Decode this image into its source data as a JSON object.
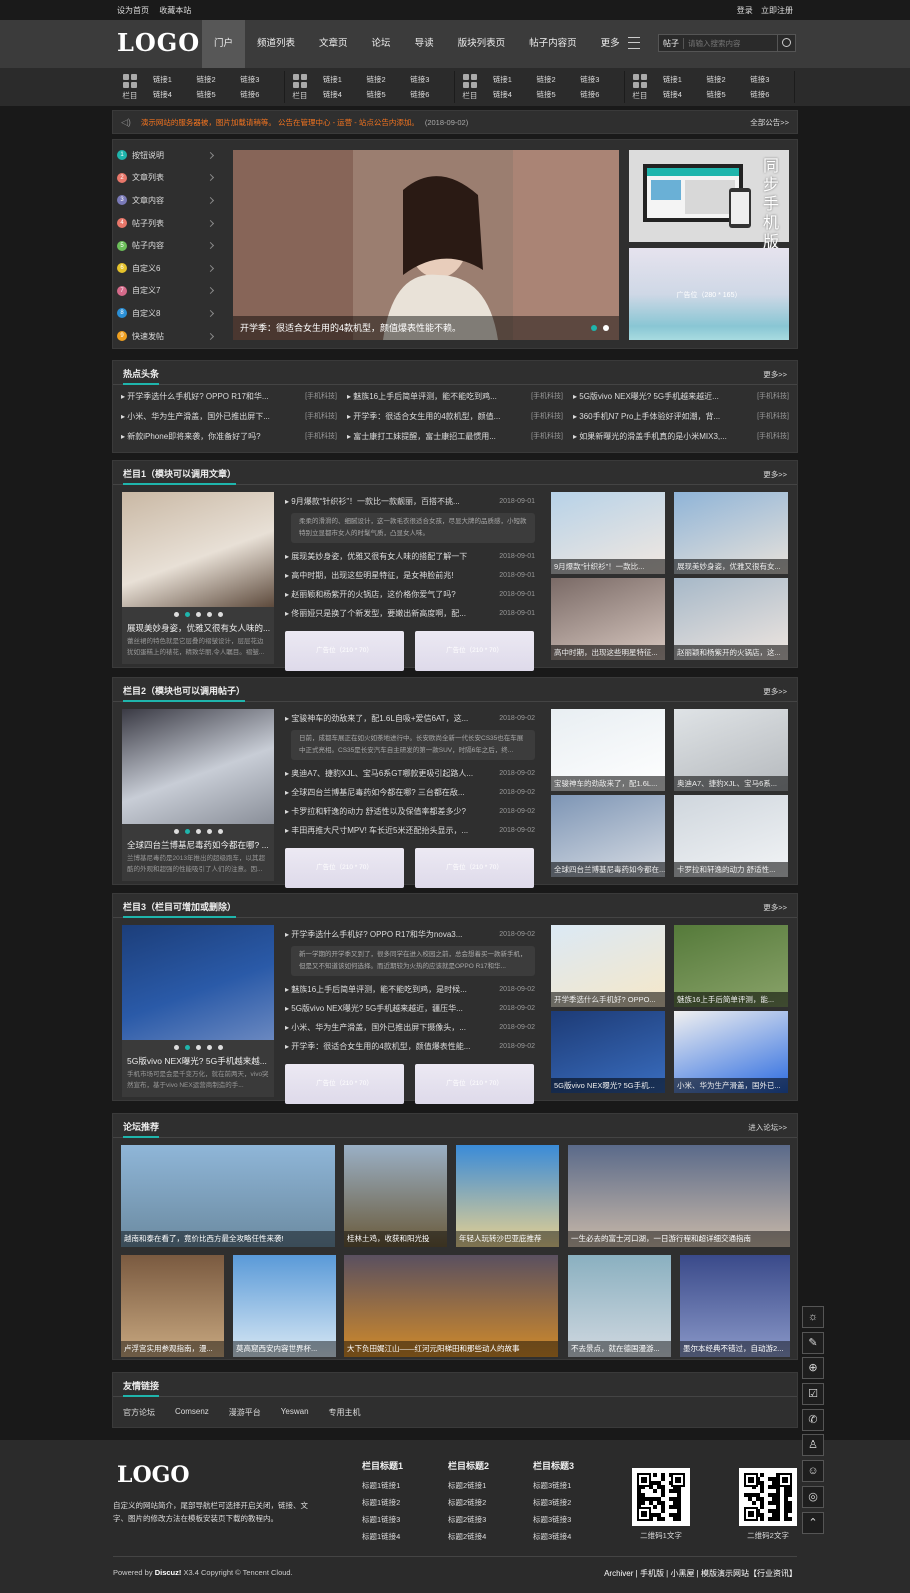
{
  "topbar": {
    "left": [
      "设为首页",
      "收藏本站"
    ],
    "right": [
      "登录",
      "立即注册"
    ]
  },
  "header": {
    "logo": "LOGO",
    "nav": [
      "门户",
      "频道列表",
      "文章页",
      "论坛",
      "导读",
      "版块列表页",
      "帖子内容页",
      "更多"
    ],
    "search_type": "帖子",
    "search_placeholder": "请输入搜索内容"
  },
  "subnav": [
    {
      "label": "栏目",
      "links": [
        "链接1",
        "链接2",
        "链接3",
        "链接4",
        "链接5",
        "链接6"
      ]
    },
    {
      "label": "栏目",
      "links": [
        "链接1",
        "链接2",
        "链接3",
        "链接4",
        "链接5",
        "链接6"
      ]
    },
    {
      "label": "栏目",
      "links": [
        "链接1",
        "链接2",
        "链接3",
        "链接4",
        "链接5",
        "链接6"
      ]
    },
    {
      "label": "栏目",
      "links": [
        "链接1",
        "链接2",
        "链接3",
        "链接4",
        "链接5",
        "链接6"
      ]
    }
  ],
  "notice": {
    "text": "演示网站的服务器被，图片加载请稍等。 公告在管理中心 - 运营 - 站点公告内添加。",
    "date": "(2018-09-02)",
    "more": "全部公告>>"
  },
  "sidebar": [
    {
      "num": "1",
      "label": "按钮说明",
      "color": "#1fb5ac"
    },
    {
      "num": "2",
      "label": "文章列表",
      "color": "#e8776a"
    },
    {
      "num": "3",
      "label": "文章内容",
      "color": "#7a7ab8"
    },
    {
      "num": "4",
      "label": "帖子列表",
      "color": "#e8776a"
    },
    {
      "num": "5",
      "label": "帖子内容",
      "color": "#6cbf5a"
    },
    {
      "num": "6",
      "label": "自定义6",
      "color": "#e5c22b"
    },
    {
      "num": "7",
      "label": "自定义7",
      "color": "#d56a8a"
    },
    {
      "num": "8",
      "label": "自定义8",
      "color": "#2a8fd6"
    },
    {
      "num": "9",
      "label": "快速发帖",
      "color": "#f0a020"
    }
  ],
  "slider": {
    "caption": "开学季：很适合女生用的4款机型，颜值爆表性能不赖。"
  },
  "hero_right": {
    "promo": "同步手机版",
    "ad": "广告位（280 * 165）"
  },
  "hot": {
    "title": "热点头条",
    "more": "更多>>",
    "items": [
      {
        "t": "开学季选什么手机好? OPPO R17和华...",
        "tag": "[手机科技]"
      },
      {
        "t": "魅族16上手后简单评测，能不能吃到鸡...",
        "tag": "[手机科技]"
      },
      {
        "t": "5G版vivo NEX曝光? 5G手机越来越近...",
        "tag": "[手机科技]"
      },
      {
        "t": "小米、华为生产滑盖，国外已推出屏下...",
        "tag": "[手机科技]"
      },
      {
        "t": "开学季：很适合女生用的4款机型，颜值...",
        "tag": "[手机科技]"
      },
      {
        "t": "360手机N7 Pro上手体验好评如潮，背...",
        "tag": "[手机科技]"
      },
      {
        "t": "新款iPhone即将来袭，你准备好了吗?",
        "tag": "[手机科技]"
      },
      {
        "t": "富士康打工妹提醒，富士康招工最惯用...",
        "tag": "[手机科技]"
      },
      {
        "t": "如果新曝光的滑盖手机真的是小米MIX3,...",
        "tag": "[手机科技]"
      }
    ]
  },
  "sections": [
    {
      "title": "栏目1（模块可以调用文章）",
      "more": "更多>>",
      "big": {
        "title": "展现美妙身姿，优雅又很有女人味的...",
        "desc": "蕾丝裙的特色就是它层叠的褶皱设计，层层花边犹如蛋糕上的裱花，精致华丽,令人瞩目。褶皱..."
      },
      "list": [
        {
          "t": "9月爆款“针织衫”！一款比一款靓丽，百搭不挑...",
          "d": "2018-09-01"
        },
        {
          "t": "展现美妙身姿，优雅又很有女人味的搭配了解一下",
          "d": "2018-09-01"
        },
        {
          "t": "高中时期，出现这些明星特征，是女神脸前兆!",
          "d": "2018-09-01"
        },
        {
          "t": "赵丽颖和杨紫开的火锅店，这价格你爱气了吗?",
          "d": "2018-09-01"
        },
        {
          "t": "佟丽娅只是换了个新发型，要嫩出新高度啊，配...",
          "d": "2018-09-01"
        }
      ],
      "summary": "柔柔的滑滑的、细腻设计，这一款毛衣很适合女孩，尽显大牌的品质感，小短款特别立显都市女人的时髦气质，凸显女人味。",
      "ads": [
        "广告位（210 * 70）",
        "广告位（210 * 70）"
      ],
      "thumbs": [
        "9月爆款“针织衫”！一款比...",
        "展现美妙身姿，优雅又很有女...",
        "高中时期，出现这些明星特征...",
        "赵丽颖和杨紫开的火锅店，这..."
      ]
    },
    {
      "title": "栏目2（模块也可以调用帖子）",
      "more": "更多>>",
      "big": {
        "title": "全球四台兰博基尼毒药如今都在哪? ...",
        "desc": "兰博基尼毒药是2013年推出的超级跑车，以其超酷的外观和超强的性能吸引了人们的注意。因..."
      },
      "list": [
        {
          "t": "宝骏神车的劲敌来了，配1.6L自吸+爱信6AT，这...",
          "d": "2018-09-02"
        },
        {
          "t": "奥迪A7、捷豹XJL、宝马6系GT哪款更吸引起路人...",
          "d": "2018-09-02"
        },
        {
          "t": "全球四台兰博基尼毒药如今都在哪? 三台都在敌...",
          "d": "2018-09-02"
        },
        {
          "t": "卡罗拉和轩逸的动力 舒适性以及保值率都差多少?",
          "d": "2018-09-02"
        },
        {
          "t": "丰田再推大尺寸MPV! 车长近5米还配抬头显示，...",
          "d": "2018-09-02"
        }
      ],
      "summary": "日前，成都车展正在如火如荼地进行中。长安欧尚全新一代长安CS35也在车展中正式亮相。CS35是长安汽车自主研发的第一款SUV，时隔6年之后，终...",
      "ads": [
        "广告位（210 * 70）",
        "广告位（210 * 70）"
      ],
      "thumbs": [
        "宝骏神车的劲敌来了，配1.6L...",
        "奥迪A7、捷豹XJL、宝马6系...",
        "全球四台兰博基尼毒药如今都在...",
        "卡罗拉和轩逸的动力 舒适性..."
      ]
    },
    {
      "title": "栏目3（栏目可增加或删除）",
      "more": "更多>>",
      "big": {
        "title": "5G版vivo NEX曝光? 5G手机越来越...",
        "desc": "手机市场可是会是千变万化，就在前两天，vivo突然宣布，基于vivo NEX运营商制造的手..."
      },
      "list": [
        {
          "t": "开学季选什么手机好? OPPO R17和华为nova3...",
          "d": "2018-09-02"
        },
        {
          "t": "魅族16上手后简单评测，能不能吃到鸡，是时候...",
          "d": "2018-09-02"
        },
        {
          "t": "5G版vivo NEX曝光? 5G手机越来越近，疆压华...",
          "d": "2018-09-02"
        },
        {
          "t": "小米、华为生产滑盖，国外已推出屏下摄像头，...",
          "d": "2018-09-02"
        },
        {
          "t": "开学季：很适合女生用的4款机型，颜值爆表性能...",
          "d": "2018-09-02"
        }
      ],
      "summary": "新一学期的开学季又到了，很多同学在进入校园之前，总会想着买一款新手机，但是又不知道该如何选择。而近期较为火热的应该就是OPPO R17和华...",
      "ads": [
        "广告位（210 * 70）",
        "广告位（210 * 70）"
      ],
      "thumbs": [
        "开学季选什么手机好? OPPO...",
        "魅族16上手后简单评测，能...",
        "5G版vivo NEX曝光? 5G手机...",
        "小米、华为生产滑盖，国外已..."
      ]
    }
  ],
  "forum": {
    "title": "论坛推荐",
    "more": "进入论坛>>",
    "items": [
      "越南和泰在看了，竟价比西方最全攻略任性来袭!",
      "桂林土鸡，收获和阳光投",
      "年轻人玩转沙巴亚庇推荐",
      "一生必去的富士河口湖，一日游行程和超详细交通指南",
      "卢浮宫实用参观指南，漫...",
      "莫高窟西安内容世界杯...",
      "大下负田娓江山——红河元阳梯田和那些动人的故事",
      "不去景点，就在德国漫游...",
      "墨尔本经典不错过，自动游2..."
    ]
  },
  "friendlinks": {
    "title": "友情链接",
    "items": [
      "官方论坛",
      "Comsenz",
      "漫游平台",
      "Yeswan",
      "专用主机"
    ]
  },
  "footer": {
    "logo": "LOGO",
    "desc": "自定义的网站简介，尾部导航栏可选择开启关闭，链接、文字、图片的修改方法在模板安装页下载的教程内。",
    "cols": [
      {
        "title": "栏目标题1",
        "links": [
          "标题1链接1",
          "标题1链接2",
          "标题1链接3",
          "标题1链接4"
        ]
      },
      {
        "title": "栏目标题2",
        "links": [
          "标题2链接1",
          "标题2链接2",
          "标题2链接3",
          "标题2链接4"
        ]
      },
      {
        "title": "栏目标题3",
        "links": [
          "标题3链接1",
          "标题3链接2",
          "标题3链接3",
          "标题3链接4"
        ]
      }
    ],
    "qr1": "二维码1文字",
    "qr2": "二维码2文字",
    "powered": "Powered by",
    "brand": "Discuz!",
    "ver": "X3.4 Copyright © Tencent Cloud.",
    "right": "Archiver | 手机版 | 小黑屋 | 模版演示网站【行业资讯】"
  }
}
